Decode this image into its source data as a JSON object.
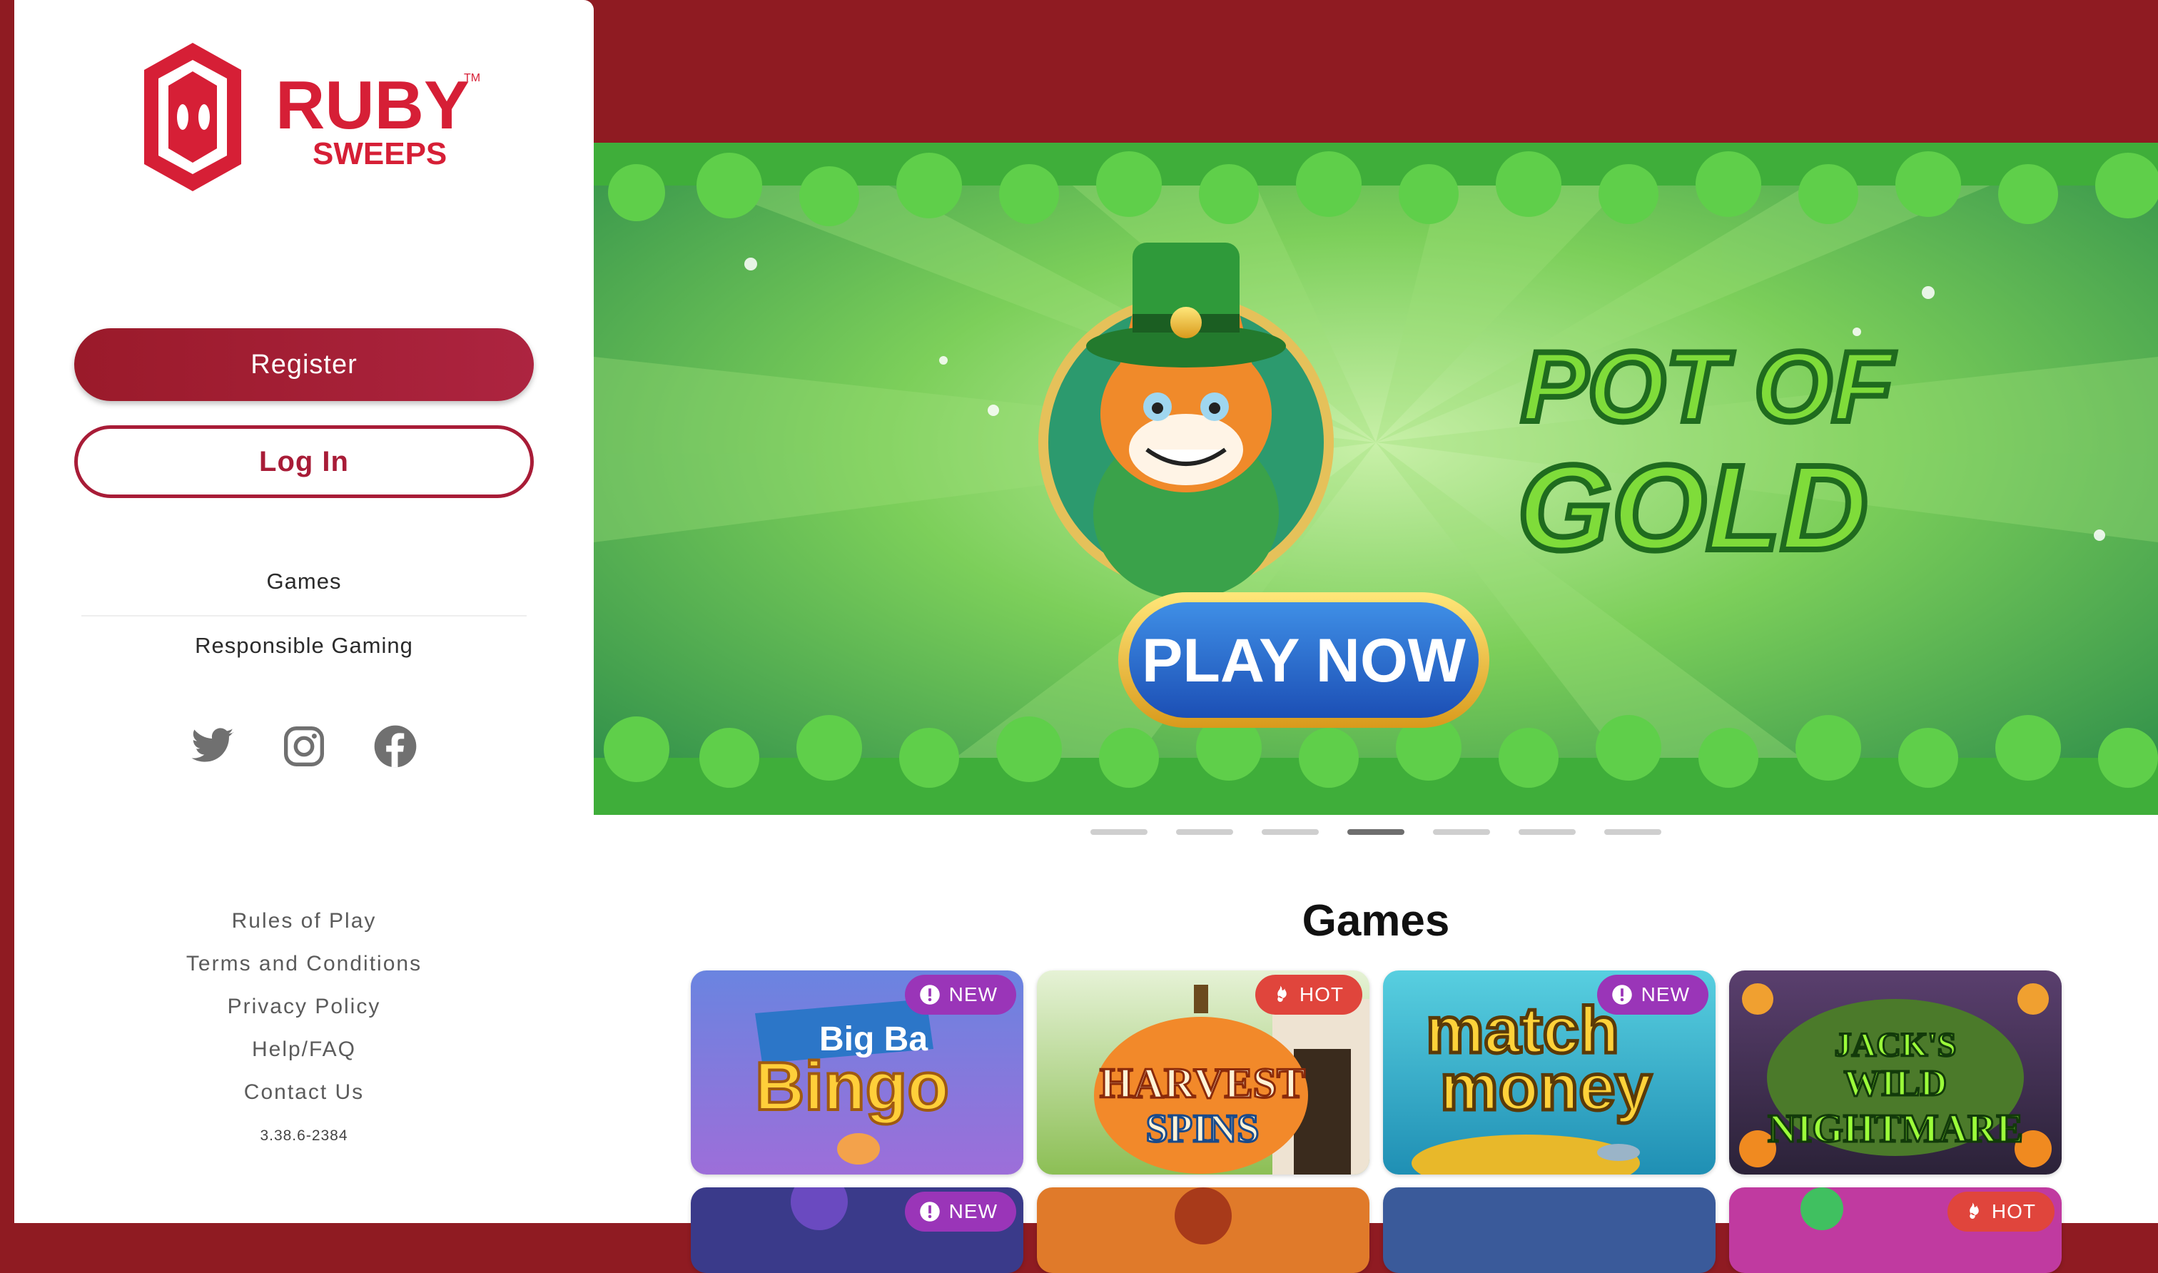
{
  "brand": {
    "name_top": "RUBY",
    "name_bottom": "SWEEPS",
    "trademark": "TM",
    "primary_color": "#a81c37",
    "header_color": "#8f1b22"
  },
  "auth": {
    "register_label": "Register",
    "login_label": "Log In"
  },
  "nav": {
    "items": [
      {
        "label": "Games"
      },
      {
        "label": "Responsible Gaming"
      }
    ]
  },
  "social": {
    "icons": [
      "twitter-icon",
      "instagram-icon",
      "facebook-icon"
    ]
  },
  "footer": {
    "links": [
      {
        "label": "Rules of Play"
      },
      {
        "label": "Terms and Conditions"
      },
      {
        "label": "Privacy Policy"
      },
      {
        "label": "Help/FAQ"
      },
      {
        "label": "Contact Us"
      }
    ],
    "version": "3.38.6-2384"
  },
  "banner": {
    "title_line1": "POT OF",
    "title_line2": "GOLD",
    "cta": "PLAY NOW",
    "slide_count": 7,
    "active_slide": 4
  },
  "games": {
    "title": "Games",
    "tiles": [
      {
        "name": "Big Bang Bingo",
        "title_a": "Big Ba",
        "title_b": "Bingo",
        "badge": "NEW",
        "badge_type": "new"
      },
      {
        "name": "Harvest Spins",
        "title_a": "HARVEST",
        "title_b": "SPINS",
        "badge": "HOT",
        "badge_type": "hot"
      },
      {
        "name": "Match Money",
        "title_a": "match",
        "title_b": "money",
        "badge": "NEW",
        "badge_type": "new"
      },
      {
        "name": "Jack's Wild Nightmare",
        "title_a": "JACK'S",
        "title_b": "WILD",
        "title_c": "NIGHTMARE",
        "badge": "",
        "badge_type": "none"
      }
    ],
    "row2_badges": [
      {
        "badge": "NEW",
        "badge_type": "new"
      },
      {
        "badge": "",
        "badge_type": "none"
      },
      {
        "badge": "",
        "badge_type": "none"
      },
      {
        "badge": "HOT",
        "badge_type": "hot"
      }
    ]
  }
}
